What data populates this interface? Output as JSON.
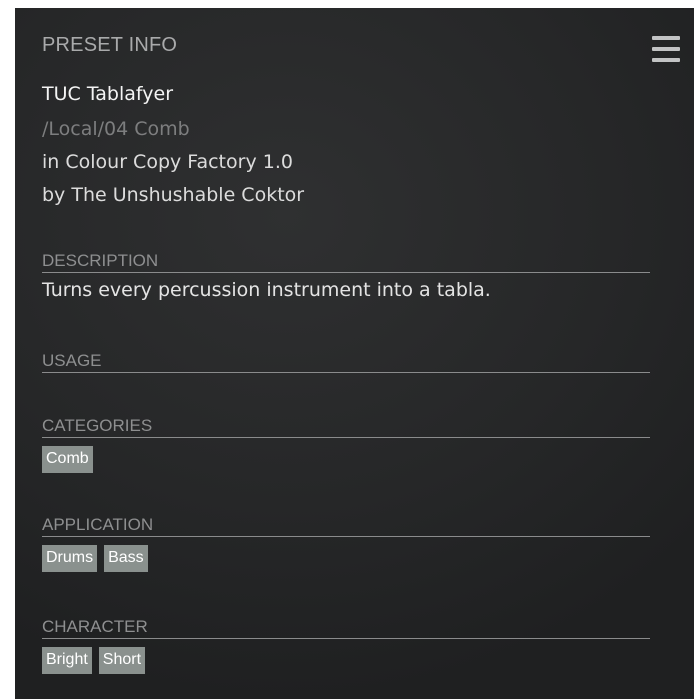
{
  "header": {
    "title": "PRESET INFO"
  },
  "preset": {
    "name": "TUC Tablafyer",
    "path": "/Local/04 Comb",
    "pack": "in Colour Copy Factory 1.0",
    "author": "by The Unshushable Coktor"
  },
  "sections": {
    "description": {
      "title": "DESCRIPTION",
      "text": "Turns every percussion instrument into a tabla."
    },
    "usage": {
      "title": "USAGE"
    },
    "categories": {
      "title": "CATEGORIES",
      "tags": [
        "Comb"
      ]
    },
    "application": {
      "title": "APPLICATION",
      "tags": [
        "Drums",
        "Bass"
      ]
    },
    "character": {
      "title": "CHARACTER",
      "tags": [
        "Bright",
        "Short"
      ]
    }
  },
  "icons": {
    "menu": "hamburger-menu-icon"
  },
  "colors": {
    "panel_background": "#28292a",
    "header_text": "#a9aaab",
    "tag_background": "#8a918e",
    "tag_text": "#ffffff",
    "section_line": "#8a8b8c"
  }
}
